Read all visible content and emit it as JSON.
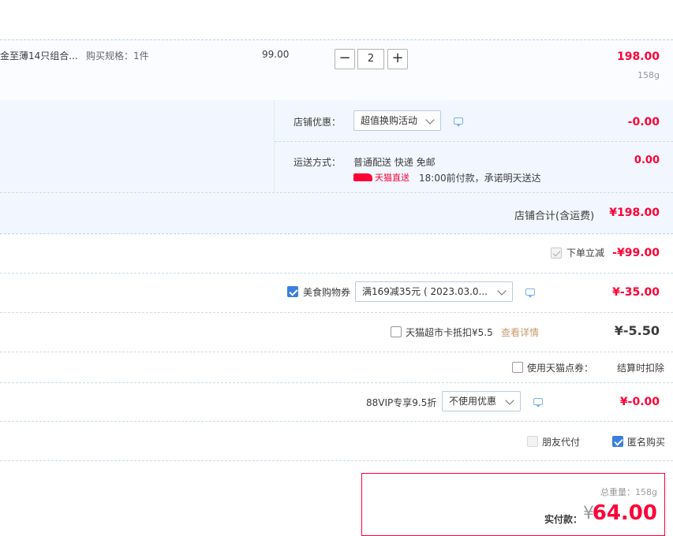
{
  "item": {
    "name": "金至薄14只组合...",
    "spec": "购买规格：1件",
    "unit_price": "99.00",
    "minus": "−",
    "quantity": "2",
    "plus": "+",
    "subtotal": "198.00",
    "weight": "158g"
  },
  "shop": {
    "discount_label": "店铺优惠：",
    "discount_select": "超值换购活动",
    "discount_amount": "-0.00",
    "shipping_label": "运送方式：",
    "shipping_method": "普通配送 快递 免邮",
    "tmall_direct": "天猫直送",
    "delivery_promise": "18:00前付款，承诺明天送达",
    "shipping_amount": "0.00",
    "total_label": "店铺合计(含运费)",
    "total_amount": "¥198.00"
  },
  "promos": {
    "instant_label": "下单立减",
    "instant_amount": "-¥99.00",
    "coupon_label": "美食购物券",
    "coupon_select": "满169减35元 ( 2023.03.0...",
    "coupon_amount": "¥-35.00",
    "card_label": "天猫超市卡抵扣¥5.5",
    "card_link": "查看详情",
    "card_amount": "¥-5.50",
    "points_label": "使用天猫点券：",
    "points_note": "结算时扣除",
    "vip_label": "88VIP专享9.5折",
    "vip_select": "不使用优惠",
    "vip_amount": "¥-0.00",
    "friend_pay": "朋友代付",
    "anonymous": "匿名购买"
  },
  "summary": {
    "weight_label": "总重量：",
    "weight_value": "158g",
    "pay_label": "实付款：",
    "currency": "¥",
    "pay_amount": "64.00"
  },
  "colors": {
    "price_red": "#ff0036",
    "accent_blue": "#3a7fe0",
    "shop_bg": "#f2f7ff",
    "summary_border": "#ff0036"
  }
}
